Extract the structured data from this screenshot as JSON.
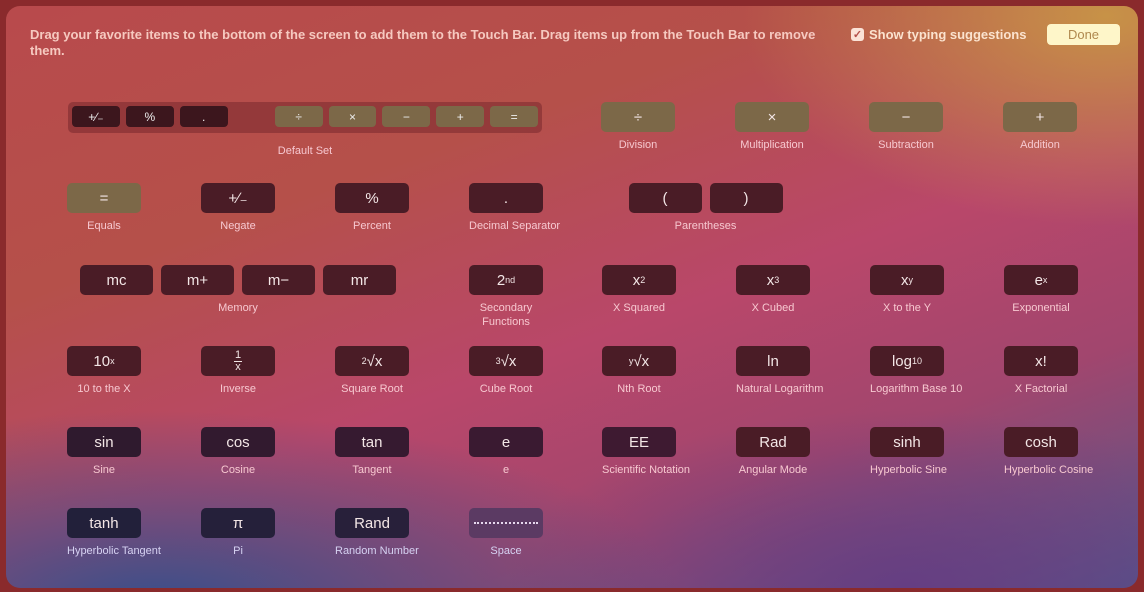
{
  "header": {
    "instructions": "Drag your favorite items to the bottom of the screen to add them to the Touch Bar. Drag items up from the Touch Bar to remove them.",
    "show_typing_suggestions_label": "Show typing suggestions",
    "show_typing_suggestions_checked": true,
    "check_glyph": "✓",
    "done_label": "Done"
  },
  "default_set": {
    "label": "Default Set",
    "keys": [
      "+∕₋",
      "%",
      ".",
      "÷",
      "×",
      "−",
      "+",
      "="
    ]
  },
  "items": {
    "division": {
      "key": "÷",
      "label": "Division"
    },
    "multiplication": {
      "key": "×",
      "label": "Multiplication"
    },
    "subtraction": {
      "key": "−",
      "label": "Subtraction"
    },
    "addition": {
      "key": "+",
      "label": "Addition"
    },
    "equals": {
      "key": "=",
      "label": "Equals"
    },
    "negate": {
      "key": "+∕₋",
      "label": "Negate"
    },
    "percent": {
      "key": "%",
      "label": "Percent"
    },
    "decimal": {
      "key": ".",
      "label": "Decimal Separator"
    },
    "parentheses": {
      "keys": [
        "(",
        ")"
      ],
      "label": "Parentheses"
    },
    "memory": {
      "keys": [
        "mc",
        "m+",
        "m−",
        "mr"
      ],
      "label": "Memory"
    },
    "secondary": {
      "key_base": "2",
      "key_sup": "nd",
      "label": "Secondary Functions"
    },
    "x_squared": {
      "key_base": "x",
      "key_sup": "2",
      "label": "X Squared"
    },
    "x_cubed": {
      "key_base": "x",
      "key_sup": "3",
      "label": "X Cubed"
    },
    "x_to_y": {
      "key_base": "x",
      "key_sup": "y",
      "label": "X to the Y"
    },
    "exponential": {
      "key_base": "e",
      "key_sup": "x",
      "label": "Exponential"
    },
    "ten_to_x": {
      "key_base": "10",
      "key_sup": "x",
      "label": "10 to the X"
    },
    "inverse": {
      "num": "1",
      "den": "x",
      "label": "Inverse"
    },
    "square_root": {
      "key_sup": "2",
      "key_base": "√x",
      "label": "Square Root"
    },
    "cube_root": {
      "key_sup": "3",
      "key_base": "√x",
      "label": "Cube Root"
    },
    "nth_root": {
      "key_sup": "y",
      "key_base": "√x",
      "label": "Nth Root"
    },
    "ln": {
      "key": "ln",
      "label": "Natural Logarithm"
    },
    "log10": {
      "key_base": "log",
      "key_sub": "10",
      "label": "Logarithm Base 10"
    },
    "factorial": {
      "key": "x!",
      "label": "X Factorial"
    },
    "sin": {
      "key": "sin",
      "label": "Sine"
    },
    "cos": {
      "key": "cos",
      "label": "Cosine"
    },
    "tan": {
      "key": "tan",
      "label": "Tangent"
    },
    "e": {
      "key": "e",
      "label": "e"
    },
    "ee": {
      "key": "EE",
      "label": "Scientific Notation"
    },
    "rad": {
      "key": "Rad",
      "label": "Angular Mode"
    },
    "sinh": {
      "key": "sinh",
      "label": "Hyperbolic Sine"
    },
    "cosh": {
      "key": "cosh",
      "label": "Hyperbolic Cosine"
    },
    "tanh": {
      "key": "tanh",
      "label": "Hyperbolic Tangent"
    },
    "pi": {
      "key": "π",
      "label": "Pi"
    },
    "rand": {
      "key": "Rand",
      "label": "Random Number"
    },
    "space": {
      "label": "Space"
    }
  }
}
